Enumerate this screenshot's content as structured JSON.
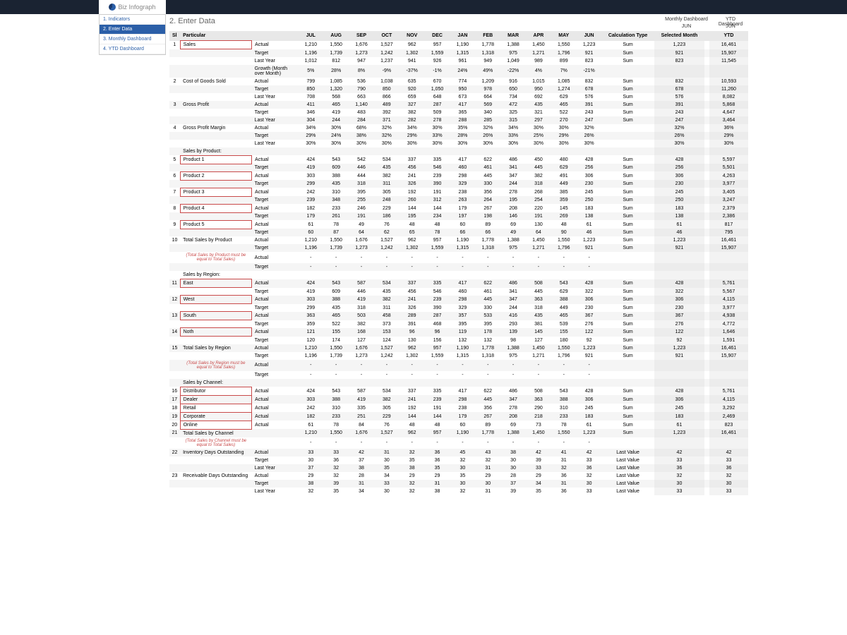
{
  "logo": {
    "b": "Biz",
    "i": "Infograph"
  },
  "sidebar": {
    "items": [
      {
        "label": "1. Indicators"
      },
      {
        "label": "2. Enter Data"
      },
      {
        "label": "3. Monthly Dashboard"
      },
      {
        "label": "4. YTD Dashboard"
      }
    ],
    "active": 1
  },
  "page_title": "2. Enter Data",
  "header": {
    "monthly": "Monthly Dashboard",
    "ytd": "YTD Dashboard",
    "monthly_sub": "JUN",
    "ytd_sub": "JUN"
  },
  "columns": {
    "sl": "Sl",
    "particular": "Particular",
    "months": [
      "JUL",
      "AUG",
      "SEP",
      "OCT",
      "NOV",
      "DEC",
      "JAN",
      "FEB",
      "MAR",
      "APR",
      "MAY",
      "JUN"
    ],
    "calc_type": "Calculation Type",
    "selected": "Selected Month",
    "ytd": "YTD"
  },
  "rows": [
    {
      "sl": "1",
      "part": "Sales",
      "sub": "Actual",
      "m": [
        "1,210",
        "1,550",
        "1,676",
        "1,527",
        "962",
        "957",
        "1,190",
        "1,778",
        "1,388",
        "1,450",
        "1,550",
        "1,223"
      ],
      "calc": "Sum",
      "sel": "1,223",
      "ytd": "16,461",
      "rb": true
    },
    {
      "sl": "",
      "part": "",
      "sub": "Target",
      "m": [
        "1,196",
        "1,739",
        "1,273",
        "1,242",
        "1,302",
        "1,559",
        "1,315",
        "1,318",
        "975",
        "1,271",
        "1,796",
        "921"
      ],
      "calc": "Sum",
      "sel": "921",
      "ytd": "15,907"
    },
    {
      "sl": "",
      "part": "",
      "sub": "Last Year",
      "m": [
        "1,012",
        "812",
        "947",
        "1,237",
        "941",
        "926",
        "961",
        "949",
        "1,049",
        "989",
        "899",
        "823"
      ],
      "calc": "Sum",
      "sel": "823",
      "ytd": "11,545"
    },
    {
      "sl": "",
      "part": "",
      "sub": "Growth (Month over Month)",
      "m": [
        "5%",
        "28%",
        "8%",
        "-9%",
        "-37%",
        "-1%",
        "24%",
        "49%",
        "-22%",
        "4%",
        "7%",
        "-21%"
      ],
      "calc": "",
      "sel": "",
      "ytd": ""
    },
    {
      "sl": "2",
      "part": "Cost of Goods Sold",
      "sub": "Actual",
      "m": [
        "799",
        "1,085",
        "536",
        "1,038",
        "635",
        "670",
        "774",
        "1,209",
        "916",
        "1,015",
        "1,085",
        "832"
      ],
      "calc": "Sum",
      "sel": "832",
      "ytd": "10,593"
    },
    {
      "sl": "",
      "part": "",
      "sub": "Target",
      "m": [
        "850",
        "1,320",
        "790",
        "850",
        "920",
        "1,050",
        "950",
        "978",
        "650",
        "950",
        "1,274",
        "678"
      ],
      "calc": "Sum",
      "sel": "678",
      "ytd": "11,260"
    },
    {
      "sl": "",
      "part": "",
      "sub": "Last Year",
      "m": [
        "708",
        "568",
        "663",
        "866",
        "659",
        "648",
        "673",
        "664",
        "734",
        "692",
        "629",
        "576"
      ],
      "calc": "Sum",
      "sel": "576",
      "ytd": "8,082"
    },
    {
      "sl": "3",
      "part": "Gross Profit",
      "sub": "Actual",
      "m": [
        "411",
        "465",
        "1,140",
        "489",
        "327",
        "287",
        "417",
        "569",
        "472",
        "435",
        "465",
        "391"
      ],
      "calc": "Sum",
      "sel": "391",
      "ytd": "5,868"
    },
    {
      "sl": "",
      "part": "",
      "sub": "Target",
      "m": [
        "346",
        "419",
        "483",
        "392",
        "382",
        "509",
        "365",
        "340",
        "325",
        "321",
        "522",
        "243"
      ],
      "calc": "Sum",
      "sel": "243",
      "ytd": "4,647"
    },
    {
      "sl": "",
      "part": "",
      "sub": "Last Year",
      "m": [
        "304",
        "244",
        "284",
        "371",
        "282",
        "278",
        "288",
        "285",
        "315",
        "297",
        "270",
        "247"
      ],
      "calc": "Sum",
      "sel": "247",
      "ytd": "3,464"
    },
    {
      "sl": "4",
      "part": "Gross Profit Margin",
      "sub": "Actual",
      "m": [
        "34%",
        "30%",
        "68%",
        "32%",
        "34%",
        "30%",
        "35%",
        "32%",
        "34%",
        "30%",
        "30%",
        "32%"
      ],
      "calc": "",
      "sel": "32%",
      "ytd": "36%"
    },
    {
      "sl": "",
      "part": "",
      "sub": "Target",
      "m": [
        "29%",
        "24%",
        "38%",
        "32%",
        "29%",
        "33%",
        "28%",
        "26%",
        "33%",
        "25%",
        "29%",
        "26%"
      ],
      "calc": "",
      "sel": "26%",
      "ytd": "29%"
    },
    {
      "sl": "",
      "part": "",
      "sub": "Last Year",
      "m": [
        "30%",
        "30%",
        "30%",
        "30%",
        "30%",
        "30%",
        "30%",
        "30%",
        "30%",
        "30%",
        "30%",
        "30%"
      ],
      "calc": "",
      "sel": "30%",
      "ytd": "30%"
    },
    {
      "section": "Sales by Product:"
    },
    {
      "sl": "5",
      "part": "Product 1",
      "sub": "Actual",
      "m": [
        "424",
        "543",
        "542",
        "534",
        "337",
        "335",
        "417",
        "622",
        "486",
        "450",
        "480",
        "428"
      ],
      "calc": "Sum",
      "sel": "428",
      "ytd": "5,597",
      "rb": true
    },
    {
      "sl": "",
      "part": "",
      "sub": "Target",
      "m": [
        "419",
        "609",
        "446",
        "435",
        "456",
        "546",
        "460",
        "461",
        "341",
        "445",
        "629",
        "256"
      ],
      "calc": "Sum",
      "sel": "256",
      "ytd": "5,501"
    },
    {
      "sl": "6",
      "part": "Product 2",
      "sub": "Actual",
      "m": [
        "303",
        "388",
        "444",
        "382",
        "241",
        "239",
        "298",
        "445",
        "347",
        "382",
        "491",
        "306"
      ],
      "calc": "Sum",
      "sel": "306",
      "ytd": "4,263",
      "rb": true
    },
    {
      "sl": "",
      "part": "",
      "sub": "Target",
      "m": [
        "299",
        "435",
        "318",
        "311",
        "326",
        "390",
        "329",
        "330",
        "244",
        "318",
        "449",
        "230"
      ],
      "calc": "Sum",
      "sel": "230",
      "ytd": "3,977"
    },
    {
      "sl": "7",
      "part": "Product 3",
      "sub": "Actual",
      "m": [
        "242",
        "310",
        "395",
        "305",
        "192",
        "191",
        "238",
        "356",
        "278",
        "268",
        "385",
        "245"
      ],
      "calc": "Sum",
      "sel": "245",
      "ytd": "3,405",
      "rb": true
    },
    {
      "sl": "",
      "part": "",
      "sub": "Target",
      "m": [
        "239",
        "348",
        "255",
        "248",
        "260",
        "312",
        "263",
        "264",
        "195",
        "254",
        "359",
        "250"
      ],
      "calc": "Sum",
      "sel": "250",
      "ytd": "3,247"
    },
    {
      "sl": "8",
      "part": "Product 4",
      "sub": "Actual",
      "m": [
        "182",
        "233",
        "246",
        "229",
        "144",
        "144",
        "179",
        "267",
        "208",
        "220",
        "145",
        "183"
      ],
      "calc": "Sum",
      "sel": "183",
      "ytd": "2,379",
      "rb": true
    },
    {
      "sl": "",
      "part": "",
      "sub": "Target",
      "m": [
        "179",
        "261",
        "191",
        "186",
        "195",
        "234",
        "197",
        "198",
        "146",
        "191",
        "269",
        "138"
      ],
      "calc": "Sum",
      "sel": "138",
      "ytd": "2,386"
    },
    {
      "sl": "9",
      "part": "Product 5",
      "sub": "Actual",
      "m": [
        "61",
        "78",
        "49",
        "76",
        "48",
        "48",
        "60",
        "89",
        "69",
        "130",
        "48",
        "61"
      ],
      "calc": "Sum",
      "sel": "61",
      "ytd": "817",
      "rb": true
    },
    {
      "sl": "",
      "part": "",
      "sub": "Target",
      "m": [
        "60",
        "87",
        "64",
        "62",
        "65",
        "78",
        "66",
        "66",
        "49",
        "64",
        "90",
        "46"
      ],
      "calc": "Sum",
      "sel": "46",
      "ytd": "795"
    },
    {
      "sl": "10",
      "part": "Total Sales by Product",
      "sub": "Actual",
      "m": [
        "1,210",
        "1,550",
        "1,676",
        "1,527",
        "962",
        "957",
        "1,190",
        "1,778",
        "1,388",
        "1,450",
        "1,550",
        "1,223"
      ],
      "calc": "Sum",
      "sel": "1,223",
      "ytd": "16,461"
    },
    {
      "sl": "",
      "part": "",
      "sub": "Target",
      "m": [
        "1,196",
        "1,739",
        "1,273",
        "1,242",
        "1,302",
        "1,559",
        "1,315",
        "1,318",
        "975",
        "1,271",
        "1,796",
        "921"
      ],
      "calc": "Sum",
      "sel": "921",
      "ytd": "15,907"
    },
    {
      "note": "(Total Sales by Product must be equal to Total Sales)",
      "sub": "Actual",
      "m": [
        "-",
        "-",
        "-",
        "-",
        "-",
        "-",
        "-",
        "-",
        "-",
        "-",
        "-",
        "-"
      ],
      "calc": "",
      "sel": "",
      "ytd": ""
    },
    {
      "sl": "",
      "part": "",
      "sub": "Target",
      "m": [
        "-",
        "-",
        "-",
        "-",
        "-",
        "-",
        "-",
        "-",
        "-",
        "-",
        "-",
        "-"
      ],
      "calc": "",
      "sel": "",
      "ytd": ""
    },
    {
      "section": "Sales by Region:"
    },
    {
      "sl": "11",
      "part": "East",
      "sub": "Actual",
      "m": [
        "424",
        "543",
        "587",
        "534",
        "337",
        "335",
        "417",
        "622",
        "486",
        "508",
        "543",
        "428"
      ],
      "calc": "Sum",
      "sel": "428",
      "ytd": "5,761",
      "rb": true
    },
    {
      "sl": "",
      "part": "",
      "sub": "Target",
      "m": [
        "419",
        "609",
        "446",
        "435",
        "456",
        "546",
        "460",
        "461",
        "341",
        "445",
        "629",
        "322"
      ],
      "calc": "Sum",
      "sel": "322",
      "ytd": "5,567"
    },
    {
      "sl": "12",
      "part": "West",
      "sub": "Actual",
      "m": [
        "303",
        "388",
        "419",
        "382",
        "241",
        "239",
        "298",
        "445",
        "347",
        "363",
        "388",
        "306"
      ],
      "calc": "Sum",
      "sel": "306",
      "ytd": "4,115",
      "rb": true
    },
    {
      "sl": "",
      "part": "",
      "sub": "Target",
      "m": [
        "299",
        "435",
        "318",
        "311",
        "326",
        "390",
        "329",
        "330",
        "244",
        "318",
        "449",
        "230"
      ],
      "calc": "Sum",
      "sel": "230",
      "ytd": "3,977"
    },
    {
      "sl": "13",
      "part": "South",
      "sub": "Actual",
      "m": [
        "363",
        "465",
        "503",
        "458",
        "289",
        "287",
        "357",
        "533",
        "416",
        "435",
        "465",
        "367"
      ],
      "calc": "Sum",
      "sel": "367",
      "ytd": "4,938",
      "rb": true
    },
    {
      "sl": "",
      "part": "",
      "sub": "Target",
      "m": [
        "359",
        "522",
        "382",
        "373",
        "391",
        "468",
        "395",
        "395",
        "293",
        "381",
        "539",
        "276"
      ],
      "calc": "Sum",
      "sel": "276",
      "ytd": "4,772"
    },
    {
      "sl": "14",
      "part": "Noth",
      "sub": "Actual",
      "m": [
        "121",
        "155",
        "168",
        "153",
        "96",
        "96",
        "119",
        "178",
        "139",
        "145",
        "155",
        "122"
      ],
      "calc": "Sum",
      "sel": "122",
      "ytd": "1,646",
      "rb": true
    },
    {
      "sl": "",
      "part": "",
      "sub": "Target",
      "m": [
        "120",
        "174",
        "127",
        "124",
        "130",
        "156",
        "132",
        "132",
        "98",
        "127",
        "180",
        "92"
      ],
      "calc": "Sum",
      "sel": "92",
      "ytd": "1,591"
    },
    {
      "sl": "15",
      "part": "Total Sales by Region",
      "sub": "Actual",
      "m": [
        "1,210",
        "1,550",
        "1,676",
        "1,527",
        "962",
        "957",
        "1,190",
        "1,778",
        "1,388",
        "1,450",
        "1,550",
        "1,223"
      ],
      "calc": "Sum",
      "sel": "1,223",
      "ytd": "16,461"
    },
    {
      "sl": "",
      "part": "",
      "sub": "Target",
      "m": [
        "1,196",
        "1,739",
        "1,273",
        "1,242",
        "1,302",
        "1,559",
        "1,315",
        "1,318",
        "975",
        "1,271",
        "1,796",
        "921"
      ],
      "calc": "Sum",
      "sel": "921",
      "ytd": "15,907"
    },
    {
      "note": "(Total Sales by Region must be equal to Total Sales)",
      "sub": "Actual",
      "m": [
        "-",
        "-",
        "-",
        "-",
        "-",
        "-",
        "-",
        "-",
        "-",
        "-",
        "-",
        "-"
      ],
      "calc": "",
      "sel": "",
      "ytd": ""
    },
    {
      "sl": "",
      "part": "",
      "sub": "Target",
      "m": [
        "-",
        "-",
        "-",
        "-",
        "-",
        "-",
        "-",
        "-",
        "-",
        "-",
        "-",
        "-"
      ],
      "calc": "",
      "sel": "",
      "ytd": ""
    },
    {
      "section": "Sales by Channel:"
    },
    {
      "sl": "16",
      "part": "Distributor",
      "sub": "Actual",
      "m": [
        "424",
        "543",
        "587",
        "534",
        "337",
        "335",
        "417",
        "622",
        "486",
        "508",
        "543",
        "428"
      ],
      "calc": "Sum",
      "sel": "428",
      "ytd": "5,761",
      "rb": true
    },
    {
      "sl": "17",
      "part": "Dealer",
      "sub": "Actual",
      "m": [
        "303",
        "388",
        "419",
        "382",
        "241",
        "239",
        "298",
        "445",
        "347",
        "363",
        "388",
        "306"
      ],
      "calc": "Sum",
      "sel": "306",
      "ytd": "4,115",
      "rb": true
    },
    {
      "sl": "18",
      "part": "Retail",
      "sub": "Actual",
      "m": [
        "242",
        "310",
        "335",
        "305",
        "192",
        "191",
        "238",
        "356",
        "278",
        "290",
        "310",
        "245"
      ],
      "calc": "Sum",
      "sel": "245",
      "ytd": "3,292",
      "rb": true
    },
    {
      "sl": "19",
      "part": "Corporate",
      "sub": "Actual",
      "m": [
        "182",
        "233",
        "251",
        "229",
        "144",
        "144",
        "179",
        "267",
        "208",
        "218",
        "233",
        "183"
      ],
      "calc": "Sum",
      "sel": "183",
      "ytd": "2,469",
      "rb": true
    },
    {
      "sl": "20",
      "part": "Online",
      "sub": "Actual",
      "m": [
        "61",
        "78",
        "84",
        "76",
        "48",
        "48",
        "60",
        "89",
        "69",
        "73",
        "78",
        "61"
      ],
      "calc": "Sum",
      "sel": "61",
      "ytd": "823",
      "rb": true
    },
    {
      "sl": "21",
      "part": "Total Sales by Channel",
      "sub": "",
      "m": [
        "1,210",
        "1,550",
        "1,676",
        "1,527",
        "962",
        "957",
        "1,190",
        "1,778",
        "1,388",
        "1,450",
        "1,550",
        "1,223"
      ],
      "calc": "Sum",
      "sel": "1,223",
      "ytd": "16,461"
    },
    {
      "note": "(Total Sales by Channel must be equal to Total Sales)",
      "sub": "",
      "m": [
        "-",
        "-",
        "-",
        "-",
        "-",
        "-",
        "-",
        "-",
        "-",
        "-",
        "-",
        "-"
      ],
      "calc": "",
      "sel": "",
      "ytd": ""
    },
    {
      "sl": "22",
      "part": "Inventory Days Outstanding",
      "sub": "Actual",
      "m": [
        "33",
        "33",
        "42",
        "31",
        "32",
        "36",
        "45",
        "43",
        "38",
        "42",
        "41",
        "42"
      ],
      "calc": "Last Value",
      "sel": "42",
      "ytd": "42"
    },
    {
      "sl": "",
      "part": "",
      "sub": "Target",
      "m": [
        "30",
        "36",
        "37",
        "30",
        "35",
        "36",
        "32",
        "32",
        "30",
        "39",
        "31",
        "33"
      ],
      "calc": "Last Value",
      "sel": "33",
      "ytd": "33"
    },
    {
      "sl": "",
      "part": "",
      "sub": "Last Year",
      "m": [
        "37",
        "32",
        "38",
        "35",
        "38",
        "35",
        "30",
        "31",
        "30",
        "33",
        "32",
        "36"
      ],
      "calc": "Last Value",
      "sel": "36",
      "ytd": "36"
    },
    {
      "sl": "23",
      "part": "Receivable Days Outstanding",
      "sub": "Actual",
      "m": [
        "29",
        "32",
        "28",
        "34",
        "29",
        "29",
        "35",
        "29",
        "28",
        "29",
        "36",
        "32"
      ],
      "calc": "Last Value",
      "sel": "32",
      "ytd": "32"
    },
    {
      "sl": "",
      "part": "",
      "sub": "Target",
      "m": [
        "38",
        "39",
        "31",
        "33",
        "32",
        "31",
        "30",
        "30",
        "37",
        "34",
        "31",
        "30"
      ],
      "calc": "Last Value",
      "sel": "30",
      "ytd": "30"
    },
    {
      "sl": "",
      "part": "",
      "sub": "Last Year",
      "m": [
        "32",
        "35",
        "34",
        "30",
        "32",
        "38",
        "32",
        "31",
        "39",
        "35",
        "36",
        "33"
      ],
      "calc": "Last Value",
      "sel": "33",
      "ytd": "33"
    }
  ]
}
